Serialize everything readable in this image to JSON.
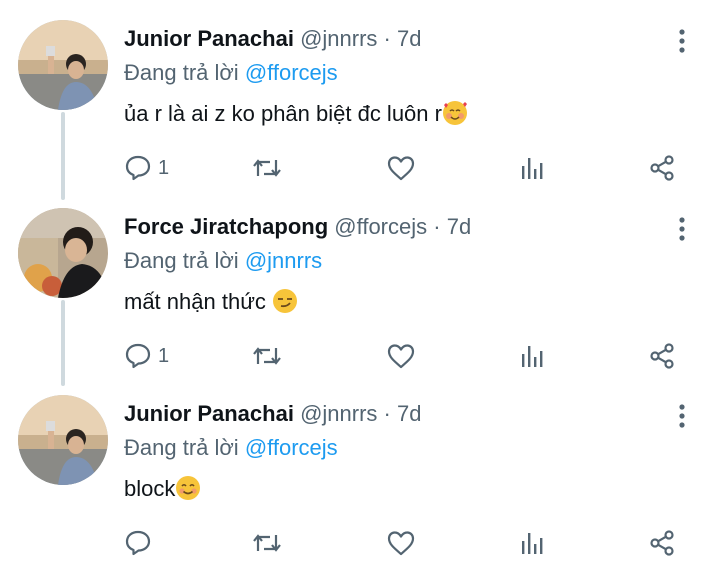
{
  "colors": {
    "link": "#1d9bf0",
    "secondary": "#536471",
    "primary": "#0f1419",
    "thread_line": "#cfd9de"
  },
  "tweets": [
    {
      "name": "Junior Panachai",
      "handle": "@jnnrrs",
      "dot": "·",
      "time": "7d",
      "reply_prefix": "Đang trả lời",
      "reply_to": "@fforcejs",
      "text": "ủa r là ai z ko phân biệt đc luôn r",
      "emoji": "smiling-face-with-hearts",
      "reply_count": "1"
    },
    {
      "name": "Force Jiratchapong",
      "handle": "@fforcejs",
      "dot": "·",
      "time": "7d",
      "reply_prefix": "Đang trả lời",
      "reply_to": "@jnnrrs",
      "text": "mất nhận thức ",
      "emoji": "smirking-face",
      "reply_count": "1"
    },
    {
      "name": "Junior Panachai",
      "handle": "@jnnrrs",
      "dot": "·",
      "time": "7d",
      "reply_prefix": "Đang trả lời",
      "reply_to": "@fforcejs",
      "text": "block",
      "emoji": "smiling-face",
      "reply_count": ""
    }
  ],
  "action_icons": [
    "reply-icon",
    "retweet-icon",
    "like-icon",
    "analytics-icon",
    "share-icon"
  ]
}
